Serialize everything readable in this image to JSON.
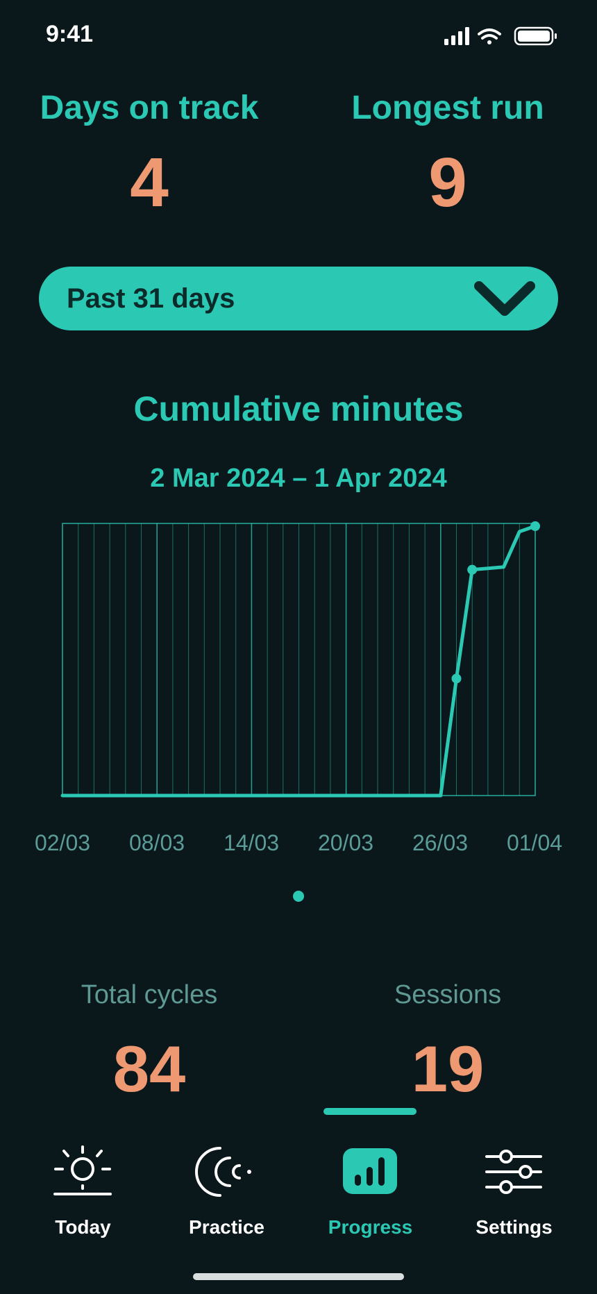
{
  "status": {
    "time": "9:41"
  },
  "stats": {
    "days_on_track": {
      "label": "Days on track",
      "value": "4"
    },
    "longest_run": {
      "label": "Longest run",
      "value": "9"
    }
  },
  "range_selector": {
    "label": "Past 31 days",
    "icon": "chevron-down-icon"
  },
  "chart": {
    "title": "Cumulative minutes",
    "subtitle": "2 Mar 2024 – 1 Apr 2024",
    "x_ticks": [
      "02/03",
      "08/03",
      "14/03",
      "20/03",
      "26/03",
      "01/04"
    ]
  },
  "chart_data": {
    "type": "line",
    "title": "Cumulative minutes",
    "subtitle": "2 Mar 2024 – 1 Apr 2024",
    "x": [
      "02/03",
      "03/03",
      "04/03",
      "05/03",
      "06/03",
      "07/03",
      "08/03",
      "09/03",
      "10/03",
      "11/03",
      "12/03",
      "13/03",
      "14/03",
      "15/03",
      "16/03",
      "17/03",
      "18/03",
      "19/03",
      "20/03",
      "21/03",
      "22/03",
      "23/03",
      "24/03",
      "25/03",
      "26/03",
      "27/03",
      "28/03",
      "29/03",
      "30/03",
      "31/03",
      "01/04"
    ],
    "series": [
      {
        "values": [
          0,
          0,
          0,
          0,
          0,
          0,
          0,
          0,
          0,
          0,
          0,
          0,
          0,
          0,
          0,
          0,
          0,
          0,
          0,
          0,
          0,
          0,
          0,
          0,
          0,
          43,
          83,
          83.5,
          84,
          97,
          99
        ]
      }
    ],
    "markers_at": [
      "27/03",
      "28/03",
      "01/04"
    ],
    "ylim": [
      0,
      100
    ],
    "y_axis_labels": false,
    "grid": "vertical-daily",
    "color": "#2bc9b4"
  },
  "page_indicator": {
    "count": 1,
    "active": 0
  },
  "totals": {
    "total_cycles": {
      "label": "Total cycles",
      "value": "84"
    },
    "sessions": {
      "label": "Sessions",
      "value": "19"
    }
  },
  "tabs": [
    {
      "label": "Today",
      "icon": "sun-icon",
      "active": false
    },
    {
      "label": "Practice",
      "icon": "practice-waves-icon",
      "active": false
    },
    {
      "label": "Progress",
      "icon": "bar-chart-icon",
      "active": true
    },
    {
      "label": "Settings",
      "icon": "sliders-icon",
      "active": false
    }
  ],
  "colors": {
    "background": "#0a171b",
    "accent": "#2bc9b4",
    "highlight": "#ef9973",
    "muted": "#5f9994"
  }
}
